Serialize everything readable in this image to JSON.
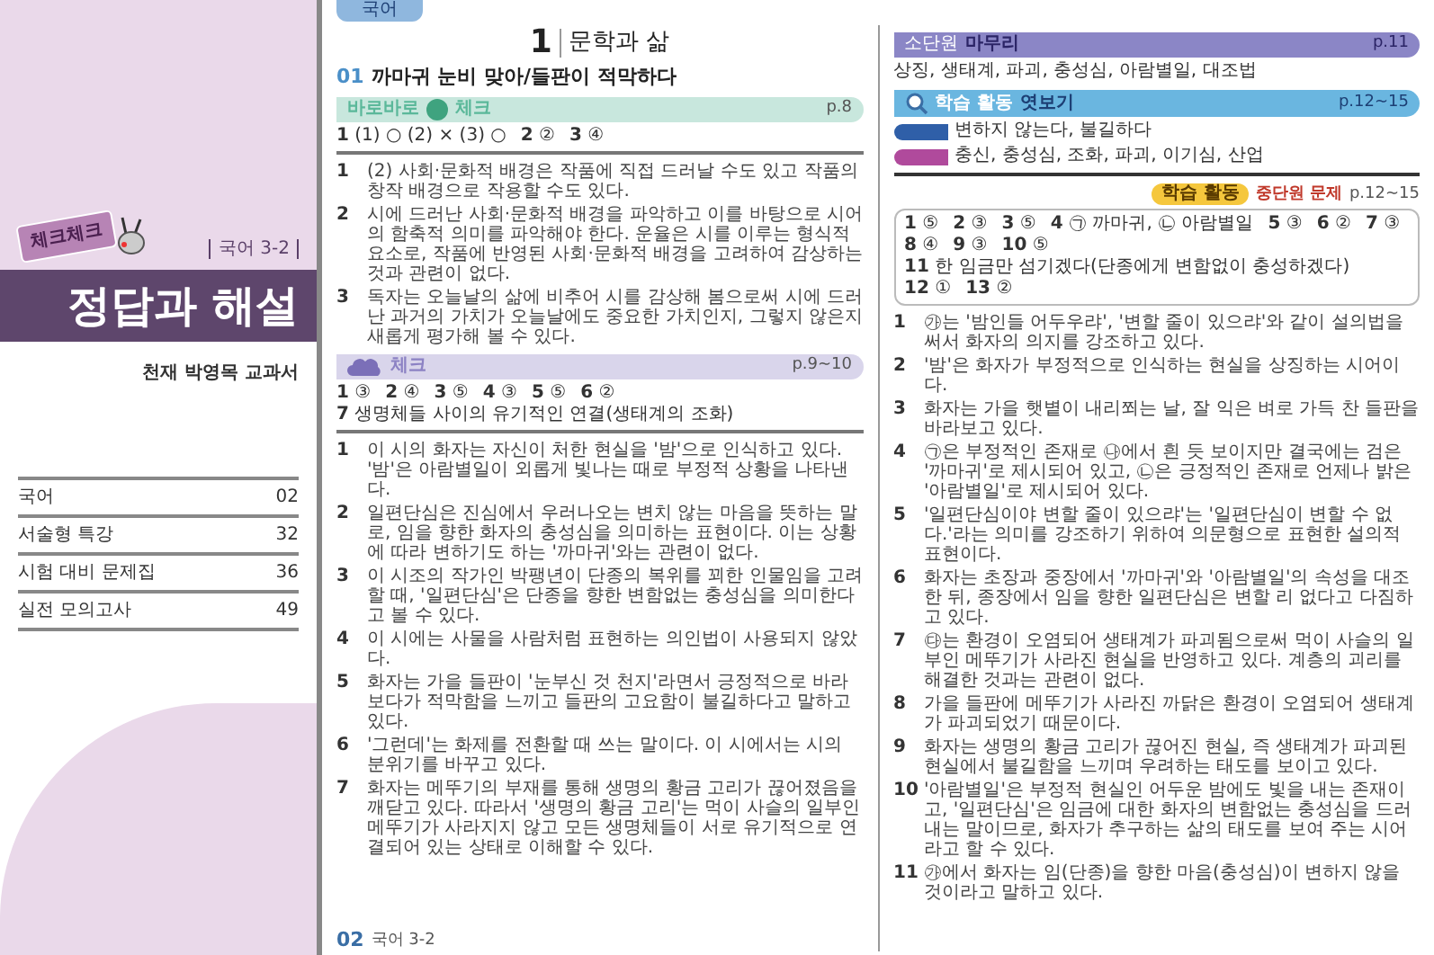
{
  "cover": {
    "badge": "체크체크",
    "subject": "국어 3-2",
    "title": "정답과 해설",
    "publisher": "천재 박영목 교과서",
    "toc": [
      {
        "label": "국어",
        "page": "02"
      },
      {
        "label": "서술형 특강",
        "page": "32"
      },
      {
        "label": "시험 대비 문제집",
        "page": "36"
      },
      {
        "label": "실전 모의고사",
        "page": "49"
      }
    ]
  },
  "page": {
    "tab": "국어",
    "chapter_number": "1",
    "chapter_title": "문학과 삶",
    "section_number": "01",
    "section_title": "까마귀 눈비 맞아/들판이 적막하다",
    "left_column": [
      {
        "kind": "check",
        "prefix": "바로바로",
        "title": "체크",
        "page": "p.8",
        "color": "#5bb89a",
        "answers": [
          {
            "number": "1",
            "answer": "(1) ○ (2) × (3) ○"
          },
          {
            "number": "2",
            "answer": "②"
          },
          {
            "number": "3",
            "answer": "④"
          }
        ],
        "items": [
          {
            "number": "1",
            "text": "(2) 사회·문화적 배경은 작품에 직접 드러날 수도 있고 작품의 창작 배경으로 작용할 수도 있다."
          },
          {
            "number": "2",
            "text": "시에 드러난 사회·문화적 배경을 파악하고 이를 바탕으로 시어의 함축적 의미를 파악해야 한다. 운율은 시를 이루는 형식적 요소로, 작품에 반영된 사회·문화적 배경을 고려하여 감상하는 것과 관련이 없다."
          },
          {
            "number": "3",
            "text": "독자는 오늘날의 삶에 비추어 시를 감상해 봄으로써 시에 드러난 과거의 가치가 오늘날에도 중요한 가치인지, 그렇지 않은지 새롭게 평가해 볼 수 있다."
          }
        ]
      },
      {
        "kind": "check",
        "title": "체크",
        "page": "p.9~10",
        "color": "#8c82c4",
        "answers": [
          {
            "number": "1",
            "answer": "③"
          },
          {
            "number": "2",
            "answer": "④"
          },
          {
            "number": "3",
            "answer": "⑤"
          },
          {
            "number": "4",
            "answer": "③"
          },
          {
            "number": "5",
            "answer": "⑤"
          },
          {
            "number": "6",
            "answer": "②"
          },
          {
            "number": "7",
            "answer": "생명체들 사이의 유기적인 연결(생태계의 조화)"
          }
        ],
        "items": [
          {
            "number": "1",
            "text": "이 시의 화자는 자신이 처한 현실을 '밤'으로 인식하고 있다. '밤'은 아람별일이 외롭게 빛나는 때로 부정적 상황을 나타낸다."
          },
          {
            "number": "2",
            "text": "일편단심은 진심에서 우러나오는 변치 않는 마음을 뜻하는 말로, 임을 향한 화자의 충성심을 의미하는 표현이다. 이는 상황에 따라 변하기도 하는 '까마귀'와는 관련이 없다."
          },
          {
            "number": "3",
            "text": "이 시조의 작가인 박팽년이 단종의 복위를 꾀한 인물임을 고려할 때, '일편단심'은 단종을 향한 변함없는 충성심을 의미한다고 볼 수 있다."
          },
          {
            "number": "4",
            "text": "이 시에는 사물을 사람처럼 표현하는 의인법이 사용되지 않았다."
          },
          {
            "number": "5",
            "text": "화자는 가을 들판이 '눈부신 것 천지'라면서 긍정적으로 바라보다가 적막함을 느끼고 들판의 고요함이 불길하다고 말하고 있다."
          },
          {
            "number": "6",
            "text": "'그런데'는 화제를 전환할 때 쓰는 말이다. 이 시에서는 시의 분위기를 바꾸고 있다."
          },
          {
            "number": "7",
            "text": "화자는 메뚜기의 부재를 통해 생명의 황금 고리가 끊어졌음을 깨닫고 있다. 따라서 '생명의 황금 고리'는 먹이 사슬의 일부인 메뚜기가 사라지지 않고 모든 생명체들이 서로 유기적으로 연결되어 있는 상태로 이해할 수 있다."
          }
        ]
      }
    ],
    "right_column": [
      {
        "kind": "review",
        "label": "소단원",
        "title": "마무리",
        "page": "p.11",
        "text": "상징, 생태계, 파괴, 충성심, 아람별일, 대조법"
      },
      {
        "kind": "preview",
        "title": "학습 활동",
        "subtitle": "엿보기",
        "page": "p.12~15",
        "rows": [
          {
            "color": "#2f5fa8",
            "text": "변하지 않는다, 불길하다"
          },
          {
            "color": "#b04a9c",
            "text": "충신, 충성심, 조화, 파괴, 이기심, 산업"
          }
        ]
      },
      {
        "kind": "activity",
        "badge": "학습 활동",
        "subtitle": "중단원 문제",
        "page": "p.12~15",
        "answers": [
          {
            "number": "1",
            "answer": "⑤"
          },
          {
            "number": "2",
            "answer": "③"
          },
          {
            "number": "3",
            "answer": "⑤"
          },
          {
            "number": "4",
            "answer": "㉠ 까마귀, ㉡ 아람별일"
          },
          {
            "number": "5",
            "answer": "③"
          },
          {
            "number": "6",
            "answer": "②"
          },
          {
            "number": "7",
            "answer": "③"
          },
          {
            "number": "8",
            "answer": "④"
          },
          {
            "number": "9",
            "answer": "③"
          },
          {
            "number": "10",
            "answer": "⑤"
          },
          {
            "number": "11",
            "answer": "한 임금만 섬기겠다(단종에게 변함없이 충성하겠다)"
          },
          {
            "number": "12",
            "answer": "①"
          },
          {
            "number": "13",
            "answer": "②"
          }
        ],
        "items": [
          {
            "number": "1",
            "text": "㉮는 '밤인들 어두우랴', '변할 줄이 있으랴'와 같이 설의법을 써서 화자의 의지를 강조하고 있다."
          },
          {
            "number": "2",
            "text": "'밤'은 화자가 부정적으로 인식하는 현실을 상징하는 시어이다."
          },
          {
            "number": "3",
            "text": "화자는 가을 햇볕이 내리쬐는 날, 잘 익은 벼로 가득 찬 들판을 바라보고 있다."
          },
          {
            "number": "4",
            "text": "㉠은 부정적인 존재로 ㉯에서 흰 듯 보이지만 결국에는 검은 '까마귀'로 제시되어 있고, ㉡은 긍정적인 존재로 언제나 밝은 '아람별일'로 제시되어 있다."
          },
          {
            "number": "5",
            "text": "'일편단심이야 변할 줄이 있으랴'는 '일편단심이 변할 수 없다.'라는 의미를 강조하기 위하여 의문형으로 표현한 설의적 표현이다."
          },
          {
            "number": "6",
            "text": "화자는 초장과 중장에서 '까마귀'와 '아람별일'의 속성을 대조한 뒤, 종장에서 임을 향한 일편단심은 변할 리 없다고 다짐하고 있다."
          },
          {
            "number": "7",
            "text": "㉰는 환경이 오염되어 생태계가 파괴됨으로써 먹이 사슬의 일부인 메뚜기가 사라진 현실을 반영하고 있다. 계층의 괴리를 해결한 것과는 관련이 없다."
          },
          {
            "number": "8",
            "text": "가을 들판에 메뚜기가 사라진 까닭은 환경이 오염되어 생태계가 파괴되었기 때문이다."
          },
          {
            "number": "9",
            "text": "화자는 생명의 황금 고리가 끊어진 현실, 즉 생태계가 파괴된 현실에서 불길함을 느끼며 우려하는 태도를 보이고 있다."
          },
          {
            "number": "10",
            "text": "'아람별일'은 부정적 현실인 어두운 밤에도 빛을 내는 존재이고, '일편단심'은 임금에 대한 화자의 변함없는 충성심을 드러내는 말이므로, 화자가 추구하는 삶의 태도를 보여 주는 시어라고 할 수 있다."
          },
          {
            "number": "11",
            "text": "㉮에서 화자는 임(단종)을 향한 마음(충성심)이 변하지 않을 것이라고 말하고 있다."
          }
        ]
      }
    ],
    "footer": {
      "page": "02",
      "label": "국어 3-2"
    }
  }
}
